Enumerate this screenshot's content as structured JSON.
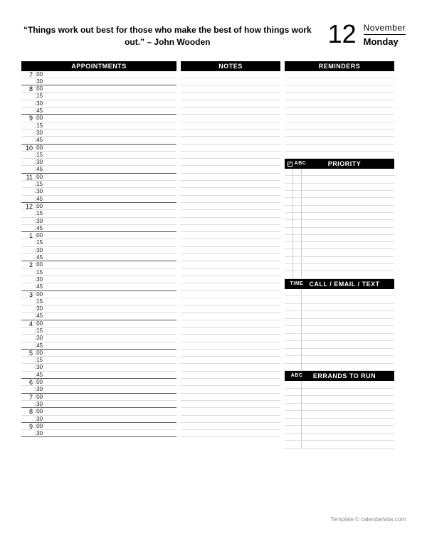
{
  "header": {
    "quote": "“Things work out best for those who make the best of how things work out.” – John Wooden",
    "day_number": "12",
    "month": "November",
    "weekday": "Monday"
  },
  "sections": {
    "appointments": "APPOINTMENTS",
    "notes": "NOTES",
    "reminders": "REMINDERS",
    "priority": "PRIORITY",
    "priority_sub": "ABC",
    "call": "CALL / EMAIL / TEXT",
    "call_sub": "TIME",
    "errands": "ERRANDS TO RUN",
    "errands_sub": "ABC"
  },
  "hours": [
    "7",
    "8",
    "9",
    "10",
    "11",
    "12",
    "1",
    "2",
    "3",
    "4",
    "5",
    "6",
    "7",
    "8",
    "9"
  ],
  "minutes_full": [
    ":00",
    ":15",
    ":30",
    ":45"
  ],
  "minutes_half": [
    ":00",
    ":30"
  ],
  "footer": "Template © calendarlabs.com"
}
